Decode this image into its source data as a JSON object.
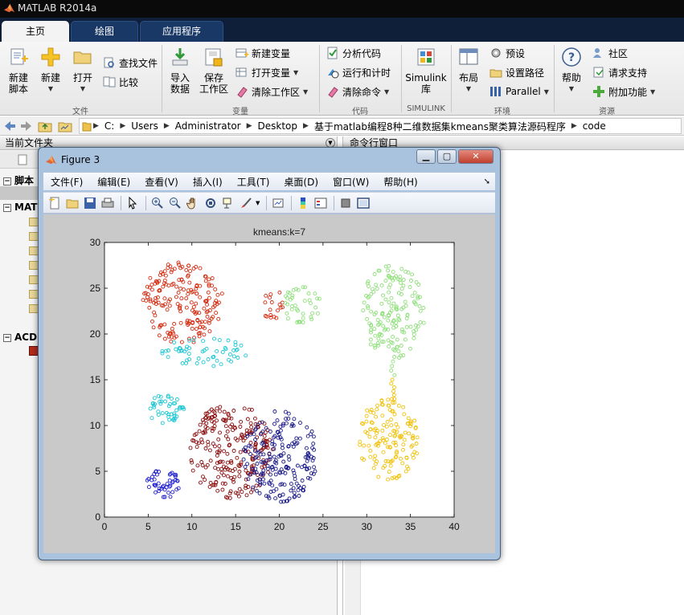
{
  "app": {
    "title": "MATLAB R2014a"
  },
  "tabs": [
    {
      "label": "主页",
      "active": true
    },
    {
      "label": "绘图",
      "active": false
    },
    {
      "label": "应用程序",
      "active": false
    }
  ],
  "ribbon": {
    "file": {
      "label": "文件",
      "new_script": "新建\n脚本",
      "new_script_l1": "新建",
      "new_script_l2": "脚本",
      "new": "新建",
      "open": "打开",
      "find_files": "查找文件",
      "compare": "比较"
    },
    "variable": {
      "label": "变量",
      "import_l1": "导入",
      "import_l2": "数据",
      "save_l1": "保存",
      "save_l2": "工作区",
      "new_variable": "新建变量",
      "open_variable": "打开变量",
      "clear_workspace": "清除工作区"
    },
    "code": {
      "label": "代码",
      "analyze": "分析代码",
      "run_time": "运行和计时",
      "clear_commands": "清除命令"
    },
    "simulink": {
      "label": "SIMULINK",
      "lib_l1": "Simulink",
      "lib_l2": "库"
    },
    "environment": {
      "label": "环境",
      "layout": "布局",
      "preferences": "预设",
      "set_path": "设置路径",
      "parallel": "Parallel"
    },
    "resources": {
      "label": "资源",
      "help": "帮助",
      "community": "社区",
      "request_support": "请求支持",
      "addons": "附加功能"
    }
  },
  "address": {
    "path": [
      "C:",
      "Users",
      "Administrator",
      "Desktop",
      "基于matlab编程8种二维数据集kmeans聚类算法源码程序",
      "code"
    ]
  },
  "left_pane": {
    "title": "当前文件夹",
    "tree": [
      {
        "label": "脚本"
      },
      {
        "label": "MAT"
      },
      {
        "label": "ACD"
      }
    ]
  },
  "right_pane": {
    "title": "命令行窗口"
  },
  "figure": {
    "title": "Figure 3",
    "menus": [
      "文件(F)",
      "编辑(E)",
      "查看(V)",
      "插入(I)",
      "工具(T)",
      "桌面(D)",
      "窗口(W)",
      "帮助(H)"
    ],
    "toolbar_icons": [
      "new-figure-icon",
      "open-file-icon",
      "save-icon",
      "print-icon",
      "select-arrow-icon",
      "zoom-in-icon",
      "zoom-out-icon",
      "pan-icon",
      "rotate-icon",
      "data-cursor-icon",
      "brush-icon",
      "link-plot-icon",
      "colorbar-icon",
      "legend-icon",
      "hide-plot-tools-icon",
      "show-plot-tools-icon"
    ]
  },
  "chart_data": {
    "type": "scatter",
    "title": "kmeans:k=7",
    "xlabel": "",
    "ylabel": "",
    "xlim": [
      0,
      40
    ],
    "ylim": [
      0,
      30
    ],
    "xticks": [
      0,
      5,
      10,
      15,
      20,
      25,
      30,
      35,
      40
    ],
    "yticks": [
      0,
      5,
      10,
      15,
      20,
      25,
      30
    ],
    "marker": "circle-open",
    "clusters": [
      {
        "color": "#d42a0f",
        "shape": "ellipse",
        "center": [
          9.0,
          23.5
        ],
        "spread": [
          4.6,
          4.6
        ],
        "count": 190
      },
      {
        "color": "#1cc7d3",
        "shape": "ellipse",
        "center": [
          11.5,
          18.0
        ],
        "spread": [
          5.0,
          1.6
        ],
        "count": 55
      },
      {
        "color": "#1cc7d3",
        "shape": "ellipse",
        "center": [
          7.0,
          11.8
        ],
        "spread": [
          2.2,
          1.6
        ],
        "count": 45
      },
      {
        "color": "#d42a0f",
        "shape": "ellipse",
        "center": [
          19.2,
          23.3
        ],
        "spread": [
          1.2,
          1.8
        ],
        "count": 18
      },
      {
        "color": "#8ee07a",
        "shape": "ellipse",
        "center": [
          22.5,
          23.2
        ],
        "spread": [
          2.3,
          2.0
        ],
        "count": 40
      },
      {
        "color": "#8ee07a",
        "shape": "ellipse",
        "center": [
          33.0,
          22.5
        ],
        "spread": [
          3.7,
          5.2
        ],
        "count": 160
      },
      {
        "color": "#8ee07a",
        "shape": "line",
        "from": [
          33.0,
          17.5
        ],
        "to": [
          33.0,
          15.5
        ],
        "count": 5
      },
      {
        "color": "#f2c10b",
        "shape": "line",
        "from": [
          33.0,
          15.0
        ],
        "to": [
          33.0,
          12.5
        ],
        "count": 7
      },
      {
        "color": "#f2c10b",
        "shape": "ellipse",
        "center": [
          32.5,
          8.5
        ],
        "spread": [
          3.5,
          4.5
        ],
        "count": 140
      },
      {
        "color": "#8b0d0d",
        "shape": "ellipse",
        "center": [
          14.5,
          7.2
        ],
        "spread": [
          4.8,
          5.2
        ],
        "count": 240
      },
      {
        "color": "#1a1a8a",
        "shape": "ellipse",
        "center": [
          20.0,
          6.6
        ],
        "spread": [
          4.5,
          5.0
        ],
        "count": 200
      },
      {
        "color": "#1f1fd0",
        "shape": "ellipse",
        "center": [
          6.7,
          3.6
        ],
        "spread": [
          1.9,
          1.6
        ],
        "count": 45
      }
    ]
  }
}
